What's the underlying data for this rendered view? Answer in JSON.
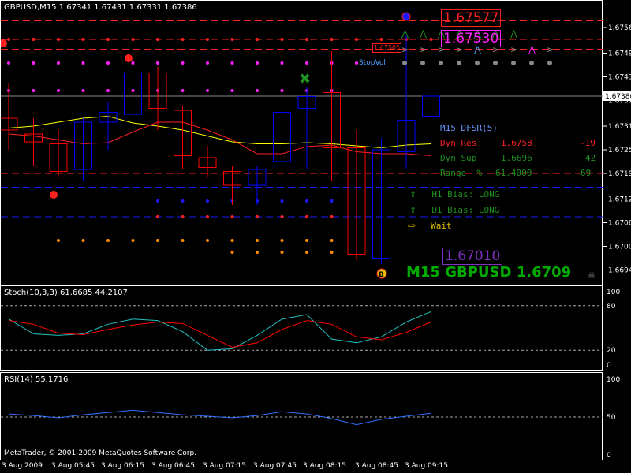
{
  "header": {
    "symbol_line": "GBPUSD,M15  1.67341 1.67431 1.67331 1.67386"
  },
  "stoch": {
    "title": "Stoch(10,3,3) 61.6685 44.2107",
    "levels": [
      "100",
      "80",
      "20",
      "0"
    ]
  },
  "rsi": {
    "title": "RSI(14) 55.1716",
    "levels": [
      "100",
      "50",
      "0"
    ]
  },
  "copyright": "MetaTrader, © 2001-2009 MetaQuotes Software Corp.",
  "price_axis": [
    "1.67560",
    "1.67495",
    "1.67435",
    "1.67375",
    "1.67310",
    "1.67250",
    "1.67190",
    "1.67125",
    "1.67065",
    "1.67005",
    "1.66945"
  ],
  "current_price": "1.67386",
  "time_axis": [
    "3 Aug 2009",
    "3 Aug 05:45",
    "3 Aug 06:15",
    "3 Aug 06:45",
    "3 Aug 07:15",
    "3 Aug 07:45",
    "3 Aug 08:15",
    "3 Aug 08:45",
    "3 Aug 09:15"
  ],
  "labels": {
    "level_res": "1.67577",
    "level_mid": "1.67530",
    "level_small": "1.67505",
    "level_sup": "1.67010",
    "stop_vol": "StopVol",
    "big_label": "M15  GBPUSD  1.6709",
    "b_marker": "B"
  },
  "dfsr": {
    "title": "M15 DFSR(5)",
    "res_label": "Dyn Res",
    "res_value": "1.6758",
    "res_pips": "-19",
    "sup_label": "Dyn Sup",
    "sup_value": "1.6696",
    "sup_pips": "42",
    "range_label": "Range| %",
    "range_value": "61.4000",
    "range_pips": "69",
    "h1_bias": "H1 Bias: LONG",
    "d1_bias": "D1 Bias: LONG",
    "signal": "Wait"
  },
  "colors": {
    "bull": "#0000ff",
    "bear": "#ff0000",
    "fast_ma": "#ffff00",
    "slow_ma": "#ff2020",
    "stoch_main": "#20c0c0",
    "stoch_signal": "#ff0000",
    "rsi": "#3070ff"
  },
  "chart_data": {
    "type": "candlestick",
    "symbol": "GBPUSD",
    "timeframe": "M15",
    "ylim": [
      1.6692,
      1.676
    ],
    "candles": [
      {
        "o": 1.6733,
        "h": 1.6742,
        "l": 1.6725,
        "c": 1.673
      },
      {
        "o": 1.6729,
        "h": 1.6733,
        "l": 1.6721,
        "c": 1.6727
      },
      {
        "o": 1.67265,
        "h": 1.673,
        "l": 1.6718,
        "c": 1.67195
      },
      {
        "o": 1.672,
        "h": 1.6733,
        "l": 1.6717,
        "c": 1.6732
      },
      {
        "o": 1.6732,
        "h": 1.6737,
        "l": 1.6725,
        "c": 1.67345
      },
      {
        "o": 1.6734,
        "h": 1.6746,
        "l": 1.6728,
        "c": 1.67445
      },
      {
        "o": 1.67445,
        "h": 1.6746,
        "l": 1.673,
        "c": 1.67355
      },
      {
        "o": 1.6735,
        "h": 1.6736,
        "l": 1.672,
        "c": 1.67235
      },
      {
        "o": 1.6723,
        "h": 1.6726,
        "l": 1.6718,
        "c": 1.67205
      },
      {
        "o": 1.67195,
        "h": 1.6721,
        "l": 1.6711,
        "c": 1.6716
      },
      {
        "o": 1.6716,
        "h": 1.6721,
        "l": 1.6711,
        "c": 1.672
      },
      {
        "o": 1.6722,
        "h": 1.674,
        "l": 1.6714,
        "c": 1.67345
      },
      {
        "o": 1.67355,
        "h": 1.6741,
        "l": 1.672,
        "c": 1.67385
      },
      {
        "o": 1.67395,
        "h": 1.675,
        "l": 1.6717,
        "c": 1.67255
      },
      {
        "o": 1.67255,
        "h": 1.673,
        "l": 1.6697,
        "c": 1.66985
      },
      {
        "o": 1.66975,
        "h": 1.6728,
        "l": 1.6696,
        "c": 1.6725
      },
      {
        "o": 1.67245,
        "h": 1.6754,
        "l": 1.672,
        "c": 1.67325
      },
      {
        "o": 1.67335,
        "h": 1.67431,
        "l": 1.67331,
        "c": 1.67386
      }
    ],
    "fast_ma": [
      1.67305,
      1.6731,
      1.6732,
      1.6733,
      1.67335,
      1.67318,
      1.6731,
      1.673,
      1.67285,
      1.6727,
      1.67265,
      1.67265,
      1.67268,
      1.67265,
      1.6726,
      1.67255,
      1.67262,
      1.67265
    ],
    "slow_ma": [
      1.6729,
      1.67285,
      1.67275,
      1.67265,
      1.67268,
      1.67295,
      1.6732,
      1.6732,
      1.673,
      1.67275,
      1.6724,
      1.6724,
      1.67258,
      1.67262,
      1.67245,
      1.6724,
      1.6724,
      1.67235
    ],
    "stoch_main": [
      62,
      42,
      40,
      42,
      55,
      62,
      60,
      45,
      20,
      22,
      40,
      62,
      68,
      35,
      30,
      38,
      58,
      72
    ],
    "stoch_signal": [
      60,
      55,
      43,
      41,
      48,
      54,
      58,
      56,
      40,
      24,
      30,
      48,
      60,
      55,
      38,
      34,
      44,
      58
    ],
    "rsi_values": [
      54,
      52,
      49,
      53,
      56,
      59,
      56,
      53,
      51,
      49,
      52,
      57,
      54,
      48,
      40,
      47,
      51,
      55
    ],
    "h_levels": [
      {
        "value": 1.67577,
        "color": "#ff2020",
        "style": "dashed"
      },
      {
        "value": 1.6753,
        "color": "#ff2020",
        "style": "dashed"
      },
      {
        "value": 1.67505,
        "color": "#ff2020",
        "style": "dashed"
      },
      {
        "value": 1.67386,
        "color": "#8a8a8a",
        "style": "solid"
      },
      {
        "value": 1.6719,
        "color": "#ff2020",
        "style": "dashed"
      },
      {
        "value": 1.67155,
        "color": "#1a1aff",
        "style": "dashed"
      },
      {
        "value": 1.6708,
        "color": "#1a1aff",
        "style": "dashed"
      },
      {
        "value": 1.66945,
        "color": "#1a1aff",
        "style": "dashed"
      }
    ]
  }
}
